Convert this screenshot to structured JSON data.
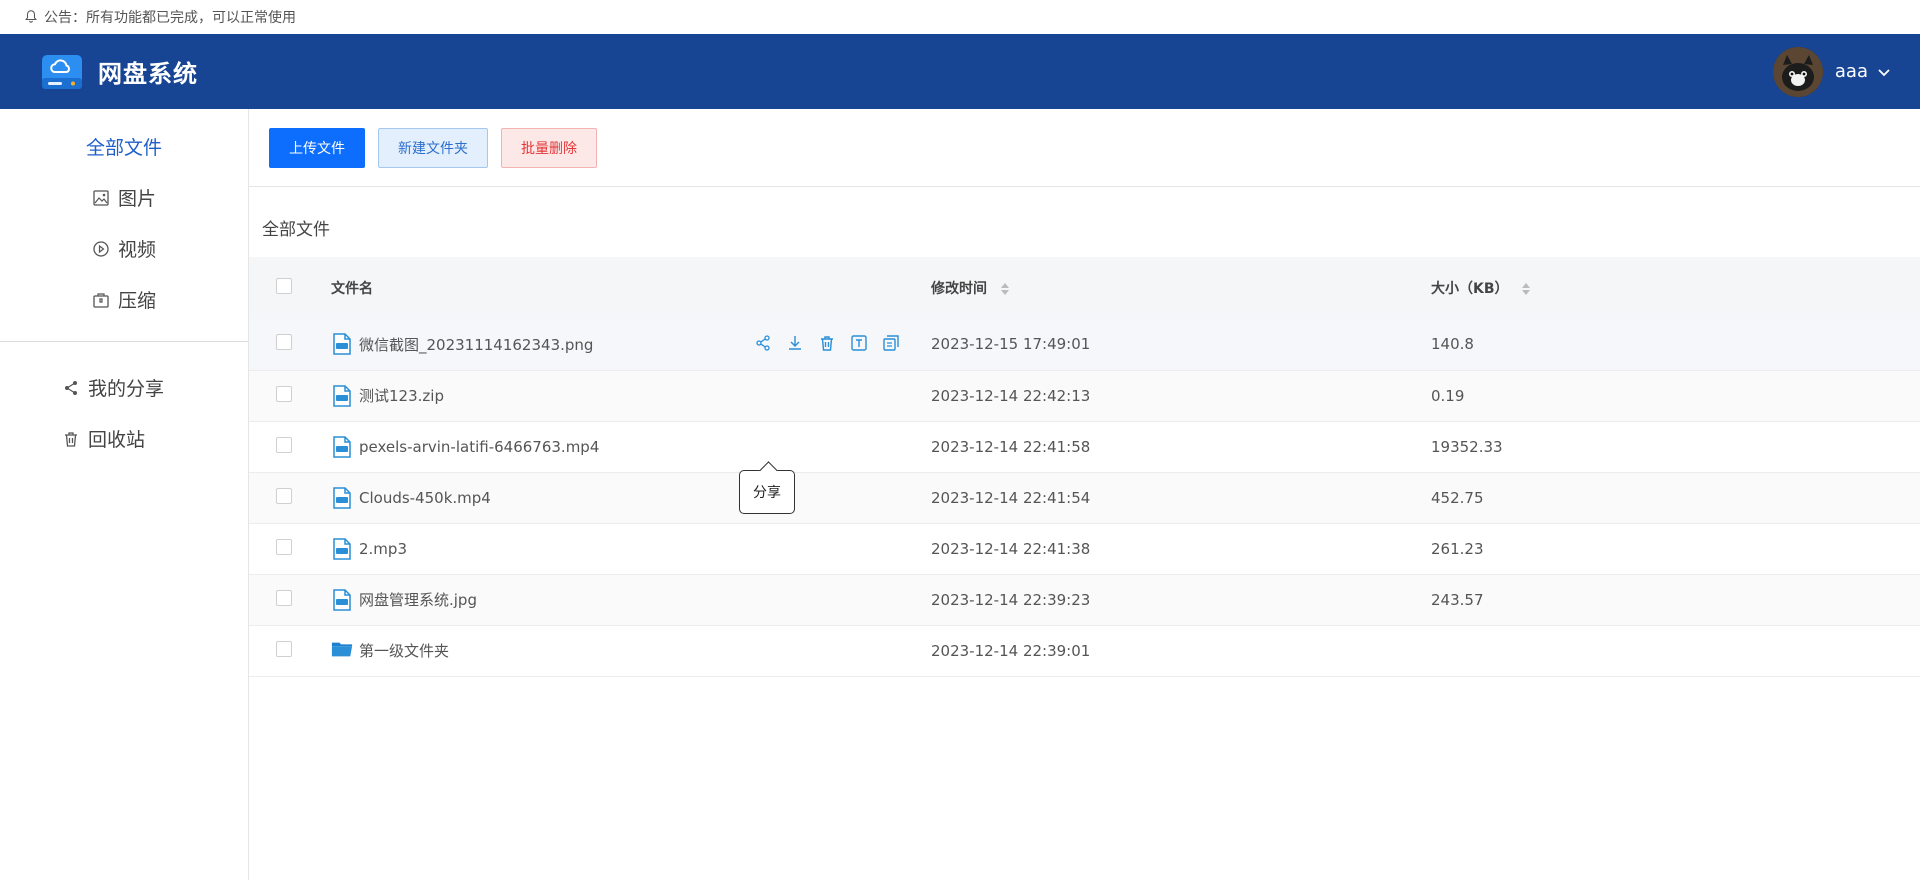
{
  "notice": {
    "text": "公告：所有功能都已完成，可以正常使用"
  },
  "header": {
    "title": "网盘系统",
    "username": "aaa"
  },
  "sidebar": {
    "items": [
      {
        "label": "全部文件",
        "icon": "none"
      },
      {
        "label": "图片",
        "icon": "image-icon"
      },
      {
        "label": "视频",
        "icon": "play-circle-icon"
      },
      {
        "label": "压缩",
        "icon": "archive-icon"
      }
    ],
    "items2": [
      {
        "label": "我的分享",
        "icon": "share-icon"
      },
      {
        "label": "回收站",
        "icon": "trash-icon"
      }
    ]
  },
  "toolbar": {
    "upload": "上传文件",
    "new_folder": "新建文件夹",
    "batch_delete": "批量删除"
  },
  "breadcrumb": "全部文件",
  "table": {
    "headers": {
      "name": "文件名",
      "time": "修改时间",
      "size": "大小（KB）"
    },
    "rows": [
      {
        "name": "微信截图_20231114162343.png",
        "time": "2023-12-15 17:49:01",
        "size": "140.8",
        "type": "file"
      },
      {
        "name": "测试123.zip",
        "time": "2023-12-14 22:42:13",
        "size": "0.19",
        "type": "file"
      },
      {
        "name": "pexels-arvin-latifi-6466763.mp4",
        "time": "2023-12-14 22:41:58",
        "size": "19352.33",
        "type": "file"
      },
      {
        "name": "Clouds-450k.mp4",
        "time": "2023-12-14 22:41:54",
        "size": "452.75",
        "type": "file"
      },
      {
        "name": "2.mp3",
        "time": "2023-12-14 22:41:38",
        "size": "261.23",
        "type": "file"
      },
      {
        "name": "网盘管理系统.jpg",
        "time": "2023-12-14 22:39:23",
        "size": "243.57",
        "type": "file"
      },
      {
        "name": "第一级文件夹",
        "time": "2023-12-14 22:39:01",
        "size": "",
        "type": "folder"
      }
    ]
  },
  "tooltip": "分享",
  "colors": {
    "header_bg": "#174594",
    "active": "#1f5fc9",
    "primary": "#0d6efd",
    "danger": "#e23636"
  }
}
